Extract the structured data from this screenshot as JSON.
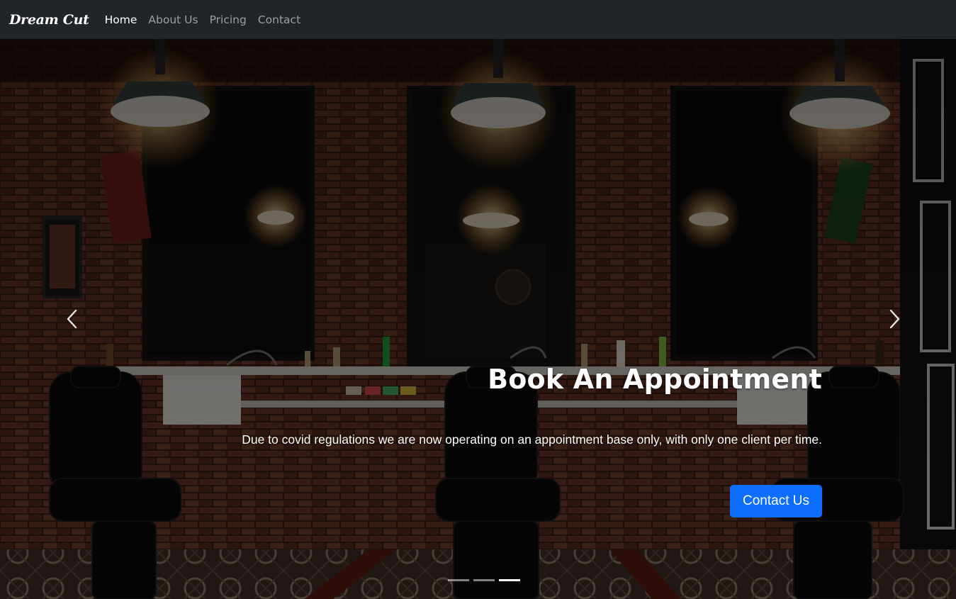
{
  "navbar": {
    "brand": "Dream Cut",
    "links": [
      {
        "label": "Home",
        "active": true
      },
      {
        "label": "About Us",
        "active": false
      },
      {
        "label": "Pricing",
        "active": false
      },
      {
        "label": "Contact",
        "active": false
      }
    ]
  },
  "carousel": {
    "caption_title": "Book An Appointment",
    "caption_text": "Due to covid regulations we are now operating on an appointment base only, with only one client per time.",
    "button_label": "Contact Us",
    "prev_icon": "chevron-left-icon",
    "next_icon": "chevron-right-icon",
    "slide_count": 3,
    "active_slide": 3
  },
  "colors": {
    "navbar_bg": "#212529",
    "primary_button": "#0d6efd"
  }
}
